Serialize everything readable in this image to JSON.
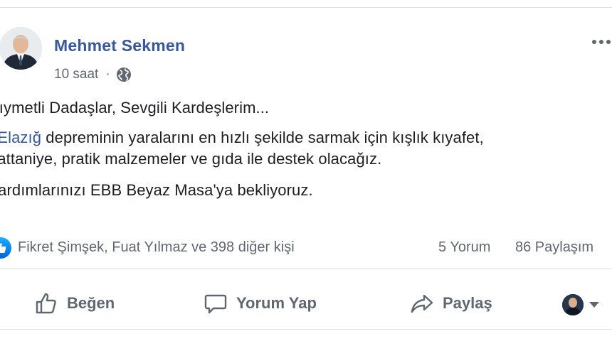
{
  "post": {
    "author": "Mehmet Sekmen",
    "time": "10 saat",
    "separator": "·",
    "body": {
      "line1": "Kıymetli Dadaşlar, Sevgili Kardeşlerim...",
      "line2_hashtag": "#Elazığ",
      "line2_rest": " depreminin yaralarını en hızlı şekilde sarmak için kışlık kıyafet,",
      "line3": "battaniye, pratik malzemeler ve gıda ile destek olacağız.",
      "line4": "Yardımlarınızı EBB Beyaz Masa'ya bekliyoruz."
    },
    "reactions": {
      "likers_text": "Fikret Şimşek, Fuat Yılmaz ve 398 diğer kişi",
      "comments_text": "5 Yorum",
      "shares_text": "86 Paylaşım"
    }
  },
  "actions": {
    "like_label": "Beğen",
    "comment_label": "Yorum Yap",
    "share_label": "Paylaş"
  },
  "icons": {
    "globe": "globe-icon",
    "more": "more-options-icon",
    "like": "thumbs-up-icon",
    "comment": "speech-bubble-icon",
    "share": "share-arrow-icon",
    "caret": "chevron-down-icon"
  },
  "colors": {
    "link": "#385898",
    "like_badge": "#1877f2",
    "muted": "#606770"
  }
}
